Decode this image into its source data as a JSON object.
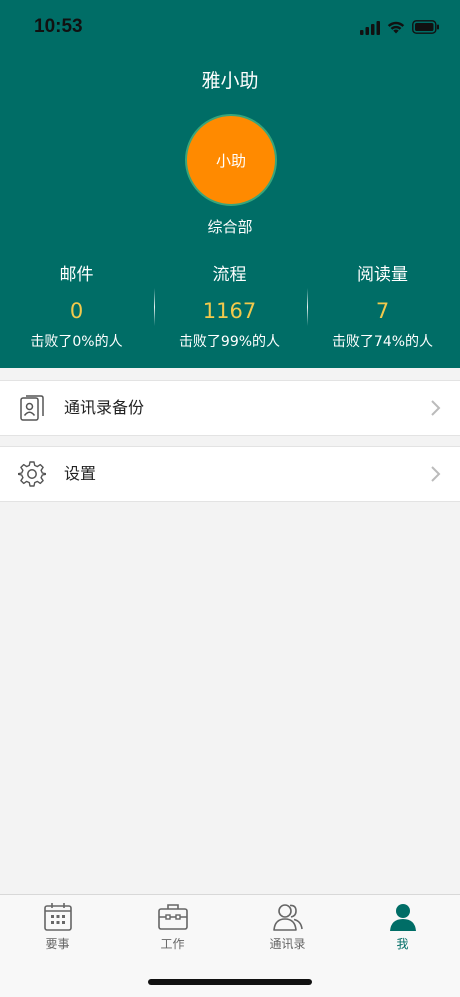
{
  "status_bar": {
    "time": "10:53",
    "icons": [
      "cellular-signal-icon",
      "wifi-icon",
      "battery-icon"
    ]
  },
  "profile": {
    "name": "雅小助",
    "avatar_text": "小助",
    "department": "综合部",
    "avatar_color": "#ff8a00",
    "header_color": "#006d66"
  },
  "stats": [
    {
      "label": "邮件",
      "value": "0",
      "rank": "击败了0%的人"
    },
    {
      "label": "流程",
      "value": "1167",
      "rank": "击败了99%的人"
    },
    {
      "label": "阅读量",
      "value": "7",
      "rank": "击败了74%的人"
    }
  ],
  "menu": [
    {
      "label": "通讯录备份",
      "icon": "contact-backup-icon"
    },
    {
      "label": "设置",
      "icon": "gear-icon"
    }
  ],
  "tabs": [
    {
      "label": "要事",
      "icon": "calendar-icon",
      "active": false
    },
    {
      "label": "工作",
      "icon": "briefcase-icon",
      "active": false
    },
    {
      "label": "通讯录",
      "icon": "contacts-icon",
      "active": false
    },
    {
      "label": "我",
      "icon": "person-icon",
      "active": true
    }
  ]
}
